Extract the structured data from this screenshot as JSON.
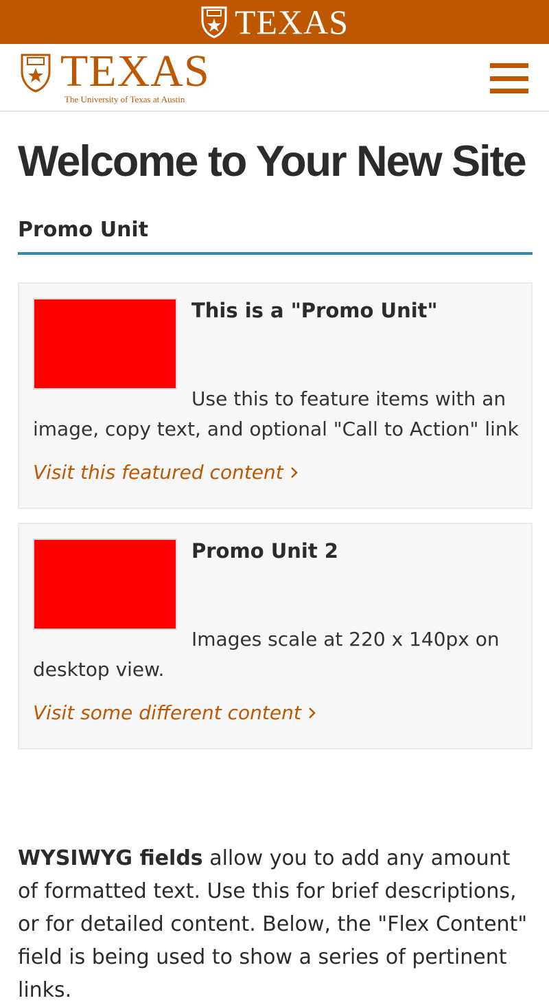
{
  "topbar": {
    "wordmark": "TEXAS",
    "seal_icon": "ut-seal-icon",
    "color": "#bf5700"
  },
  "header": {
    "wordmark": "TEXAS",
    "subtitle": "The University of Texas at Austin",
    "seal_icon": "ut-seal-icon",
    "menu_icon": "hamburger-menu-icon"
  },
  "main": {
    "page_title": "Welcome to Your New Site",
    "section_title": "Promo Unit",
    "promos": [
      {
        "headline": "This is a \"Promo Unit\"",
        "copy": "Use this to feature items with an image, copy text, and optional \"Call to Action\" link",
        "cta": "Visit this featured content",
        "image_color": "#ff0000"
      },
      {
        "headline": "Promo Unit 2",
        "copy": "Images scale at 220 x 140px on desktop view.",
        "cta": "Visit some different content",
        "image_color": "#ff0000"
      }
    ],
    "wysiwyg": {
      "bold_lead": "WYSIWYG fields",
      "text": " allow you to add any amount of formatted text. Use this for brief descriptions, or for detailed content. Below, the \"Flex Content\" field is being used to show a series of pertinent links."
    }
  },
  "colors": {
    "brand_orange": "#bf5700",
    "accent_blue": "#3b87a8"
  }
}
